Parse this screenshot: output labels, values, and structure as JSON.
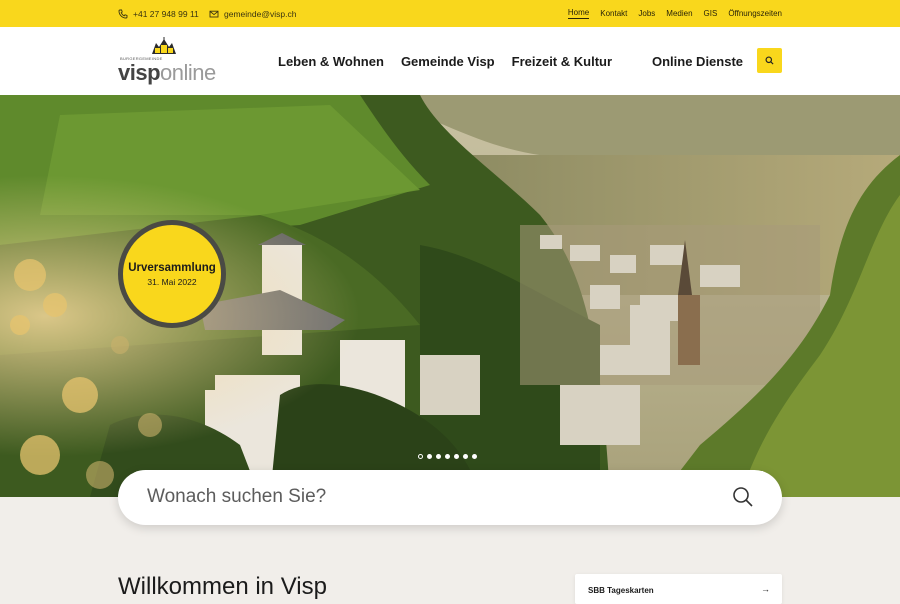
{
  "topbar": {
    "phone": "+41 27 948 99 11",
    "email": "gemeinde@visp.ch",
    "links": [
      "Home",
      "Kontakt",
      "Jobs",
      "Medien",
      "GIS",
      "Öffnungszeiten"
    ],
    "active_link": "Home",
    "bg_color": "#f9d71c"
  },
  "logo": {
    "tagline": "BURGERGEMEINDE",
    "word_a": "visp",
    "word_b": "online"
  },
  "nav": {
    "items": [
      "Leben & Wohnen",
      "Gemeinde Visp",
      "Freizeit & Kultur"
    ],
    "online": "Online Dienste",
    "search_icon": "search-icon"
  },
  "hero": {
    "badge_title": "Urversammlung",
    "badge_date": "31. Mai 2022",
    "prev_icon": "arrow-left-icon",
    "next_icon": "arrow-right-icon",
    "prev_glyph": "←",
    "next_glyph": "→",
    "slide_count": 7,
    "active_slide": 1
  },
  "search": {
    "placeholder": "Wonach suchen Sie?",
    "icon": "search-icon"
  },
  "content": {
    "welcome": "Willkommen in Visp",
    "sbb_label": "SBB Tageskarten",
    "sbb_arrow": "→"
  }
}
